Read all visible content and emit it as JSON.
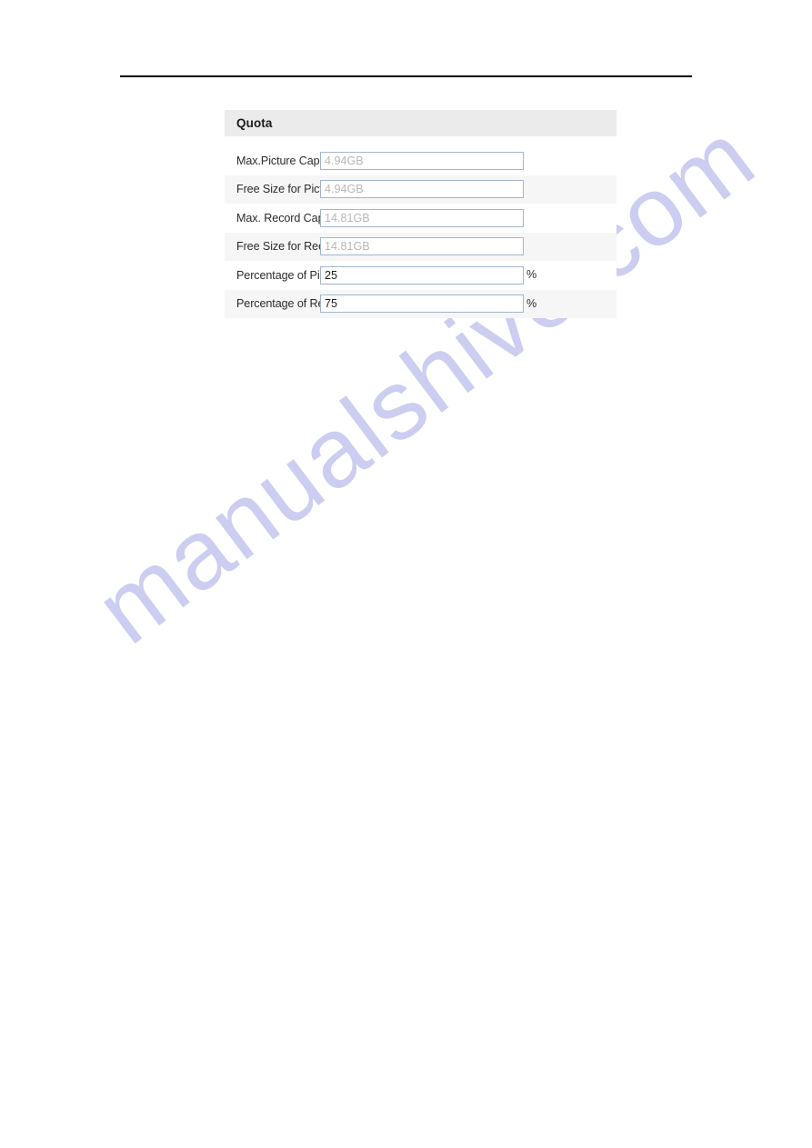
{
  "watermark": {
    "text": "manualshive.com",
    "color": "#cccdf0"
  },
  "divider": {
    "name": "top-header-rule",
    "color": "#000000"
  },
  "panel": {
    "title": "Quota",
    "header_bg": "#ebebeb",
    "shaded_row_bg": "#f6f6f6",
    "input_border": "#a3b5cb",
    "disabled_text": "#b7b7b7",
    "rows": [
      {
        "label": "Max.Picture Capacity",
        "value": "4.94GB",
        "unit": "",
        "readonly": true,
        "shaded": false
      },
      {
        "label": "Free Size for Picture",
        "value": "4.94GB",
        "unit": "",
        "readonly": true,
        "shaded": true
      },
      {
        "label": "Max. Record Capacity",
        "value": "14.81GB",
        "unit": "",
        "readonly": true,
        "shaded": false
      },
      {
        "label": "Free Size for Record",
        "value": "14.81GB",
        "unit": "",
        "readonly": true,
        "shaded": true
      },
      {
        "label": "Percentage of Picture",
        "value": "25",
        "unit": "%",
        "readonly": false,
        "shaded": false
      },
      {
        "label": "Percentage of Record",
        "value": "75",
        "unit": "%",
        "readonly": false,
        "shaded": true
      }
    ]
  }
}
